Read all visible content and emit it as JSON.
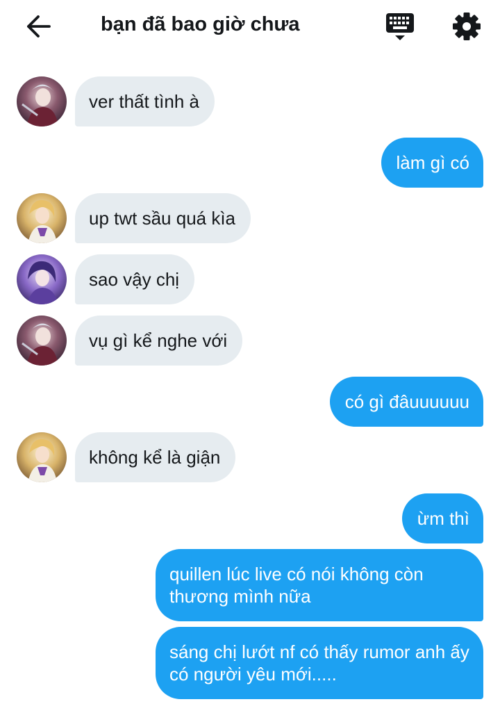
{
  "header": {
    "title": "bạn đã bao giờ chưa",
    "back_icon": "arrow-left-icon",
    "keyboard_icon": "keyboard-icon",
    "settings_icon": "gear-icon"
  },
  "messages": [
    {
      "side": "in",
      "text": "ver thất tình à",
      "avatar": "avatar-1"
    },
    {
      "side": "out",
      "text": "làm gì có"
    },
    {
      "side": "in",
      "text": "up twt sầu quá kìa",
      "avatar": "avatar-2"
    },
    {
      "side": "in",
      "text": "sao vậy chị",
      "avatar": "avatar-3"
    },
    {
      "side": "in",
      "text": "vụ gì kể nghe với",
      "avatar": "avatar-1"
    },
    {
      "side": "out",
      "text": "có gì đâuuuuuu"
    },
    {
      "side": "in",
      "text": "không kể là giận",
      "avatar": "avatar-2"
    },
    {
      "side": "out",
      "text": "ừm thì"
    },
    {
      "side": "out",
      "text": "quillen lúc live có nói không còn thương mình nữa"
    },
    {
      "side": "out",
      "text": "sáng chị lướt nf có thấy rumor anh ấy có người yêu mới....."
    }
  ],
  "colors": {
    "outgoing_bubble": "#1da1f2",
    "incoming_bubble": "#e6ecf0",
    "text_dark": "#14171a"
  }
}
